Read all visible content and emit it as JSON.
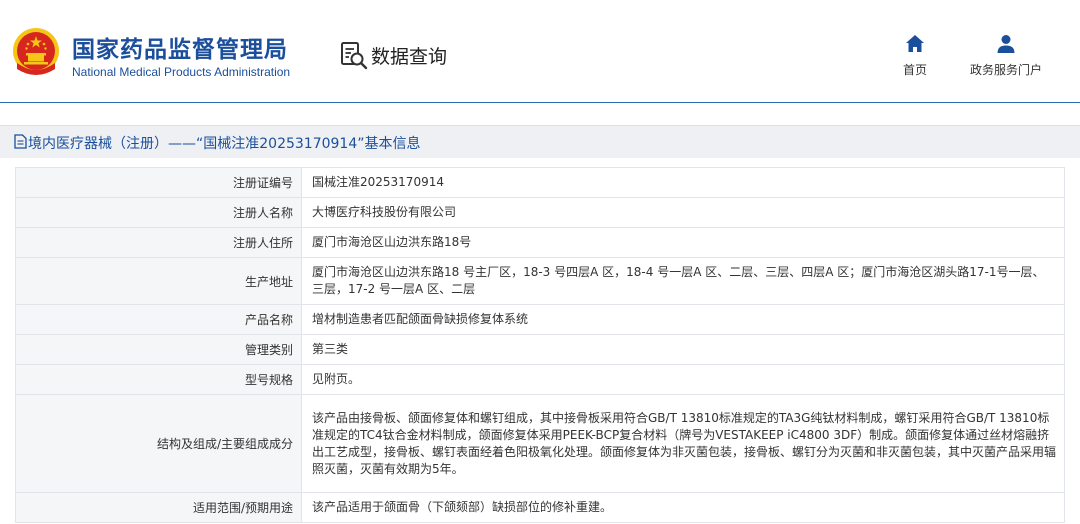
{
  "header": {
    "org_name_cn": "国家药品监督管理局",
    "org_name_en": "National Medical Products Administration",
    "query_label": "数据查询",
    "nav": [
      {
        "label": "首页",
        "icon": "home-icon"
      },
      {
        "label": "政务服务门户",
        "icon": "user-icon"
      }
    ]
  },
  "page_title": "境内医疗器械（注册）——“国械注准20253170914”基本信息",
  "rows": [
    {
      "label": "注册证编号",
      "value": "国械注准20253170914"
    },
    {
      "label": "注册人名称",
      "value": "大博医疗科技股份有限公司"
    },
    {
      "label": "注册人住所",
      "value": "厦门市海沧区山边洪东路18号"
    },
    {
      "label": "生产地址",
      "value": "厦门市海沧区山边洪东路18 号主厂区，18-3 号四层A 区，18-4 号一层A 区、二层、三层、四层A 区；厦门市海沧区湖头路17-1号一层、三层，17-2 号一层A 区、二层"
    },
    {
      "label": "产品名称",
      "value": "增材制造患者匹配颌面骨缺损修复体系统"
    },
    {
      "label": "管理类别",
      "value": "第三类"
    },
    {
      "label": "型号规格",
      "value": "见附页。"
    },
    {
      "label": "结构及组成/主要组成成分",
      "value": "该产品由接骨板、颌面修复体和螺钉组成，其中接骨板采用符合GB/T 13810标准规定的TA3G纯钛材料制成，螺钉采用符合GB/T 13810标准规定的TC4钛合金材料制成，颌面修复体采用PEEK-BCP复合材料（牌号为VESTAKEEP iC4800 3DF）制成。颌面修复体通过丝材熔融挤出工艺成型，接骨板、螺钉表面经着色阳极氧化处理。颌面修复体为非灭菌包装，接骨板、螺钉分为灭菌和非灭菌包装，其中灭菌产品采用辐照灭菌，灭菌有效期为5年。"
    },
    {
      "label": "适用范围/预期用途",
      "value": "该产品适用于颌面骨（下颌颏部）缺损部位的修补重建。"
    }
  ],
  "colors": {
    "brand_blue": "#1b4f9c",
    "emblem_red": "#d7261d",
    "emblem_gold": "#f5c518"
  }
}
